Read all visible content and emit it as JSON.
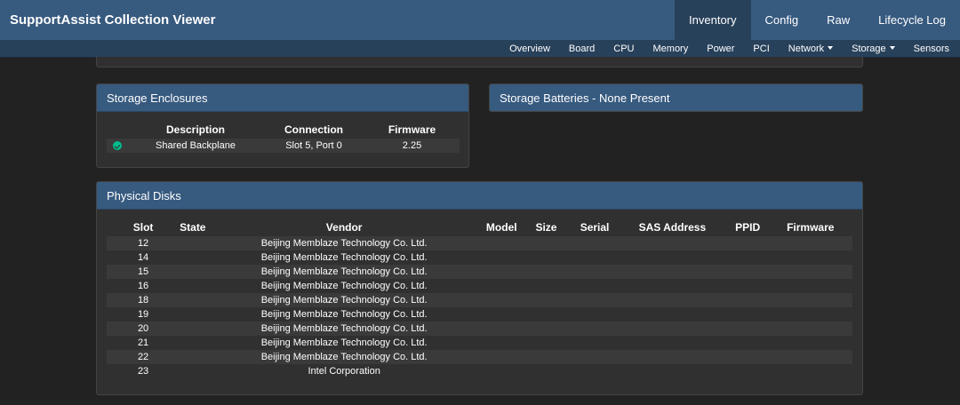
{
  "app": {
    "title": "SupportAssist Collection Viewer"
  },
  "topnav": [
    {
      "label": "Inventory",
      "active": true
    },
    {
      "label": "Config",
      "active": false
    },
    {
      "label": "Raw",
      "active": false
    },
    {
      "label": "Lifecycle Log",
      "active": false
    }
  ],
  "subnav": [
    {
      "label": "Overview",
      "dropdown": false
    },
    {
      "label": "Board",
      "dropdown": false
    },
    {
      "label": "CPU",
      "dropdown": false
    },
    {
      "label": "Memory",
      "dropdown": false
    },
    {
      "label": "Power",
      "dropdown": false
    },
    {
      "label": "PCI",
      "dropdown": false
    },
    {
      "label": "Network",
      "dropdown": true
    },
    {
      "label": "Storage",
      "dropdown": true
    },
    {
      "label": "Sensors",
      "dropdown": false
    }
  ],
  "enclosures": {
    "title": "Storage Enclosures",
    "headers": [
      "",
      "Description",
      "Connection",
      "Firmware"
    ],
    "rows": [
      {
        "status_icon": "check-circle-icon",
        "description": "Shared Backplane",
        "connection": "Slot 5, Port 0",
        "firmware": "2.25"
      }
    ]
  },
  "batteries": {
    "title": "Storage Batteries - None Present"
  },
  "disks": {
    "title": "Physical Disks",
    "headers": [
      "Slot",
      "State",
      "Vendor",
      "Model",
      "Size",
      "Serial",
      "SAS Address",
      "PPID",
      "Firmware"
    ],
    "rows": [
      {
        "slot": "12",
        "state": "",
        "vendor": "Beijing Memblaze Technology Co. Ltd.",
        "model": "",
        "size": "",
        "serial": "",
        "sas": "",
        "ppid": "",
        "firmware": ""
      },
      {
        "slot": "14",
        "state": "",
        "vendor": "Beijing Memblaze Technology Co. Ltd.",
        "model": "",
        "size": "",
        "serial": "",
        "sas": "",
        "ppid": "",
        "firmware": ""
      },
      {
        "slot": "15",
        "state": "",
        "vendor": "Beijing Memblaze Technology Co. Ltd.",
        "model": "",
        "size": "",
        "serial": "",
        "sas": "",
        "ppid": "",
        "firmware": ""
      },
      {
        "slot": "16",
        "state": "",
        "vendor": "Beijing Memblaze Technology Co. Ltd.",
        "model": "",
        "size": "",
        "serial": "",
        "sas": "",
        "ppid": "",
        "firmware": ""
      },
      {
        "slot": "18",
        "state": "",
        "vendor": "Beijing Memblaze Technology Co. Ltd.",
        "model": "",
        "size": "",
        "serial": "",
        "sas": "",
        "ppid": "",
        "firmware": ""
      },
      {
        "slot": "19",
        "state": "",
        "vendor": "Beijing Memblaze Technology Co. Ltd.",
        "model": "",
        "size": "",
        "serial": "",
        "sas": "",
        "ppid": "",
        "firmware": ""
      },
      {
        "slot": "20",
        "state": "",
        "vendor": "Beijing Memblaze Technology Co. Ltd.",
        "model": "",
        "size": "",
        "serial": "",
        "sas": "",
        "ppid": "",
        "firmware": ""
      },
      {
        "slot": "21",
        "state": "",
        "vendor": "Beijing Memblaze Technology Co. Ltd.",
        "model": "",
        "size": "",
        "serial": "",
        "sas": "",
        "ppid": "",
        "firmware": ""
      },
      {
        "slot": "22",
        "state": "",
        "vendor": "Beijing Memblaze Technology Co. Ltd.",
        "model": "",
        "size": "",
        "serial": "",
        "sas": "",
        "ppid": "",
        "firmware": ""
      },
      {
        "slot": "23",
        "state": "",
        "vendor": "Intel Corporation",
        "model": "",
        "size": "",
        "serial": "",
        "sas": "",
        "ppid": "",
        "firmware": ""
      }
    ]
  },
  "colors": {
    "primary": "#375a7f",
    "primary_dark": "#28415b",
    "background": "#222222",
    "panel": "#303030",
    "stripe": "#3a3a3a",
    "success": "#00bc8c"
  }
}
